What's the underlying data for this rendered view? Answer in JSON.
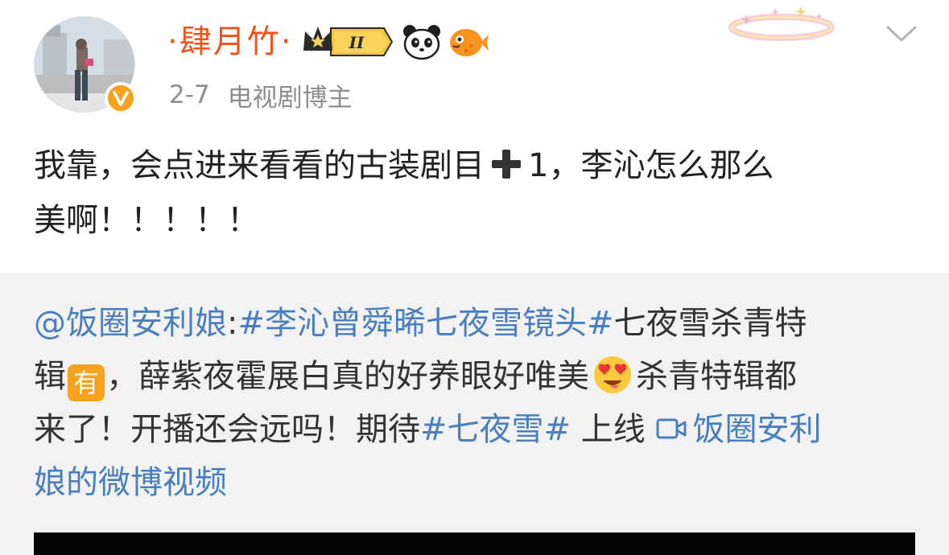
{
  "post": {
    "author": {
      "name": "·肆月竹·",
      "date": "2-7",
      "label": "电视剧博主",
      "badge_level": "II"
    },
    "text_line1": "我靠，会点进来看看的古装剧目",
    "text_line1_after": "1，李沁怎么那么",
    "text_line2": "美啊！！！！！"
  },
  "repost": {
    "mention": "@饭圈安利娘",
    "colon": ":",
    "hashtag1": "#李沁曾舜晞七夜雪镜头#",
    "text1": "七夜雪杀青特",
    "text2_a": "辑",
    "tag_you": "有",
    "text2_b": "，薛紫夜霍展白真的好养眼好唯美",
    "text2_c": "杀青特辑都",
    "text3_a": "来了！开播还会远吗！期待",
    "hashtag2": "#七夜雪#",
    "text3_b": " 上线 ",
    "video_link_1": "饭圈安利",
    "video_link_2": "娘的微博视频"
  },
  "colors": {
    "username": "#f0541e",
    "link": "#4a7fbf",
    "badge": "#f6a21f",
    "repost_bg": "#f2f2f2",
    "meta": "#8e8e8e"
  },
  "icons": [
    "verified-v-icon",
    "crown-level-badge-icon",
    "panda-icon",
    "pufferfish-icon",
    "sparkle-halo-icon",
    "chevron-down-icon",
    "plus-icon",
    "heart-eyes-emoji-icon",
    "video-camera-icon"
  ]
}
